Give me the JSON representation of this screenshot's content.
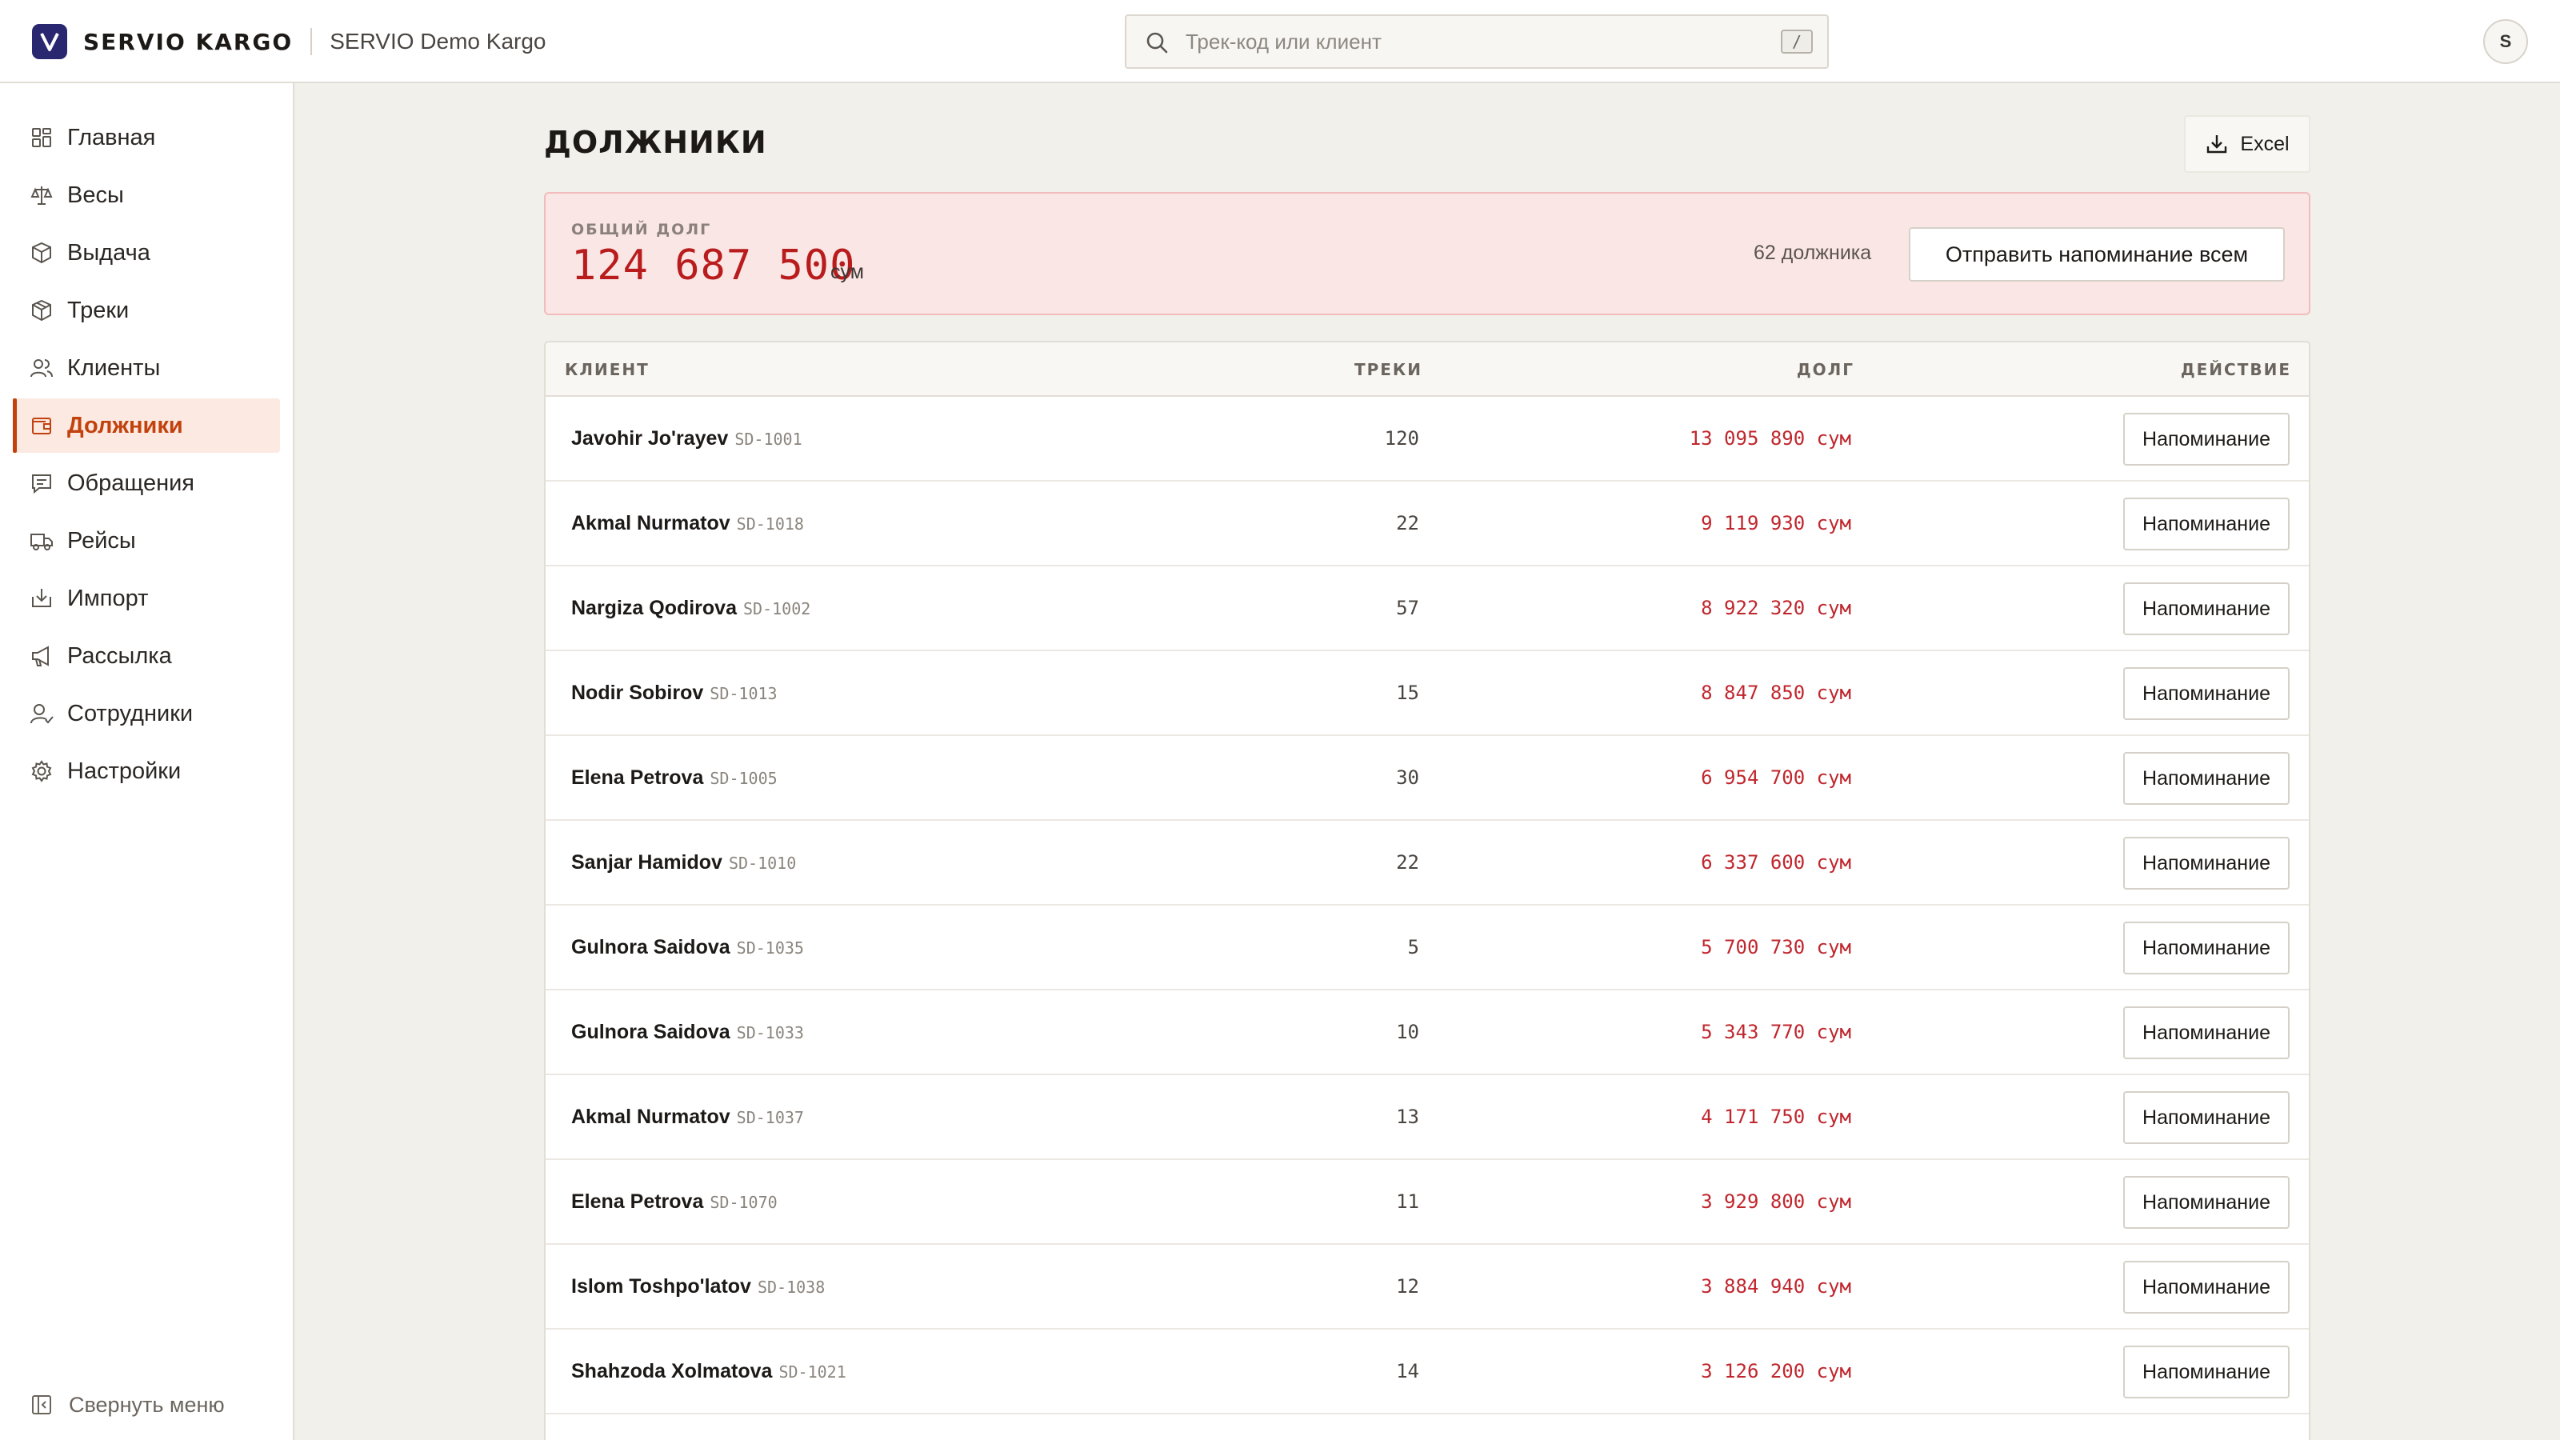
{
  "app": {
    "brand": "SERVIO KARGO",
    "company": "SERVIO Demo Kargo",
    "logo_letter": "V",
    "accent_color": "#c2410c",
    "logo_color": "#2a2771"
  },
  "search": {
    "placeholder": "Трек-код или клиент",
    "shortcut": "/"
  },
  "user": {
    "avatar_initial": "S"
  },
  "sidebar": {
    "items": [
      {
        "label": "Главная",
        "icon": "dashboard-icon",
        "active": false
      },
      {
        "label": "Весы",
        "icon": "scale-icon",
        "active": false
      },
      {
        "label": "Выдача",
        "icon": "package-icon",
        "active": false
      },
      {
        "label": "Треки",
        "icon": "box-icon",
        "active": false
      },
      {
        "label": "Клиенты",
        "icon": "users-icon",
        "active": false
      },
      {
        "label": "Должники",
        "icon": "wallet-icon",
        "active": true
      },
      {
        "label": "Обращения",
        "icon": "message-icon",
        "active": false
      },
      {
        "label": "Рейсы",
        "icon": "truck-icon",
        "active": false
      },
      {
        "label": "Импорт",
        "icon": "import-icon",
        "active": false
      },
      {
        "label": "Рассылка",
        "icon": "megaphone-icon",
        "active": false
      },
      {
        "label": "Сотрудники",
        "icon": "staff-icon",
        "active": false
      },
      {
        "label": "Настройки",
        "icon": "gear-icon",
        "active": false
      }
    ],
    "collapse_label": "Свернуть меню"
  },
  "page": {
    "title": "ДОЛЖНИКИ",
    "export_label": "Excel"
  },
  "summary": {
    "label": "ОБЩИЙ ДОЛГ",
    "amount": "124 687 500",
    "currency": "сум",
    "debtor_count": "62 должника",
    "remind_all_label": "Отправить напоминание всем"
  },
  "table": {
    "columns": {
      "client": "КЛИЕНТ",
      "tracks": "ТРЕКИ",
      "debt": "ДОЛГ",
      "action": "ДЕЙСТВИЕ"
    },
    "action_label": "Напоминание",
    "rows": [
      {
        "name": "Javohir Jo'rayev",
        "code": "SD-1001",
        "tracks": "120",
        "debt": "13 095 890 сум"
      },
      {
        "name": "Akmal Nurmatov",
        "code": "SD-1018",
        "tracks": "22",
        "debt": "9 119 930 сум"
      },
      {
        "name": "Nargiza Qodirova",
        "code": "SD-1002",
        "tracks": "57",
        "debt": "8 922 320 сум"
      },
      {
        "name": "Nodir Sobirov",
        "code": "SD-1013",
        "tracks": "15",
        "debt": "8 847 850 сум"
      },
      {
        "name": "Elena Petrova",
        "code": "SD-1005",
        "tracks": "30",
        "debt": "6 954 700 сум"
      },
      {
        "name": "Sanjar Hamidov",
        "code": "SD-1010",
        "tracks": "22",
        "debt": "6 337 600 сум"
      },
      {
        "name": "Gulnora Saidova",
        "code": "SD-1035",
        "tracks": "5",
        "debt": "5 700 730 сум"
      },
      {
        "name": "Gulnora Saidova",
        "code": "SD-1033",
        "tracks": "10",
        "debt": "5 343 770 сум"
      },
      {
        "name": "Akmal Nurmatov",
        "code": "SD-1037",
        "tracks": "13",
        "debt": "4 171 750 сум"
      },
      {
        "name": "Elena Petrova",
        "code": "SD-1070",
        "tracks": "11",
        "debt": "3 929 800 сум"
      },
      {
        "name": "Islom Toshpo'latov",
        "code": "SD-1038",
        "tracks": "12",
        "debt": "3 884 940 сум"
      },
      {
        "name": "Shahzoda Xolmatova",
        "code": "SD-1021",
        "tracks": "14",
        "debt": "3 126 200 сум"
      }
    ]
  }
}
